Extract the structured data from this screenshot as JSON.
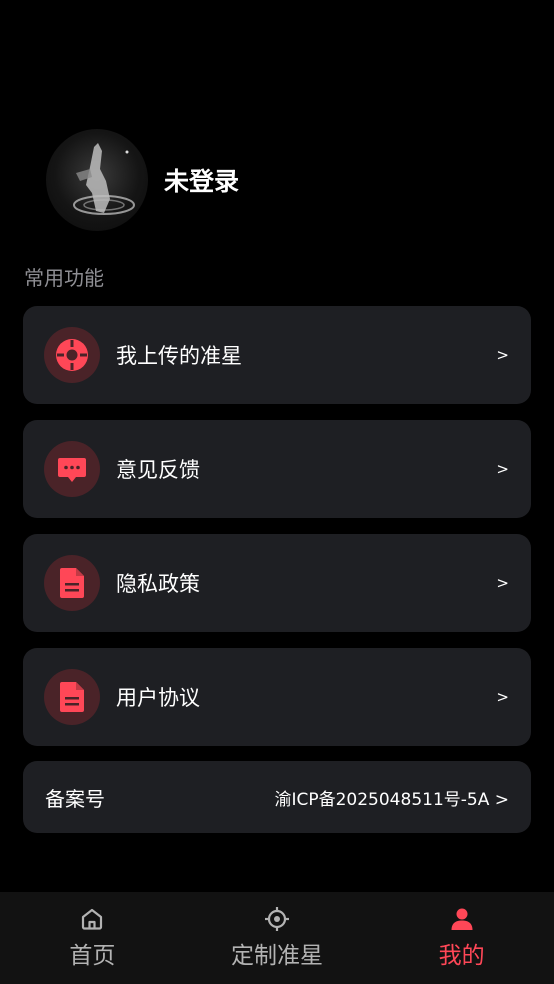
{
  "profile": {
    "username": "未登录"
  },
  "section": {
    "title": "常用功能"
  },
  "menu": [
    {
      "label": "我上传的准星",
      "icon": "crosshair-icon",
      "arrow": ">"
    },
    {
      "label": "意见反馈",
      "icon": "chat-bubble-icon",
      "arrow": ">"
    },
    {
      "label": "隐私政策",
      "icon": "document-icon",
      "arrow": ">"
    },
    {
      "label": "用户协议",
      "icon": "document-icon",
      "arrow": ">"
    }
  ],
  "record": {
    "label": "备案号",
    "value": "渝ICP备2025048511号-5A >"
  },
  "tabbar": {
    "tabs": [
      {
        "label": "首页",
        "icon": "home-icon",
        "active": false
      },
      {
        "label": "定制准星",
        "icon": "target-icon",
        "active": false
      },
      {
        "label": "我的",
        "icon": "user-icon",
        "active": true
      }
    ]
  },
  "colors": {
    "accent": "#ff4757",
    "card": "#1e1f23",
    "icon_bg": "#4a2328",
    "muted": "#8e8e93"
  }
}
